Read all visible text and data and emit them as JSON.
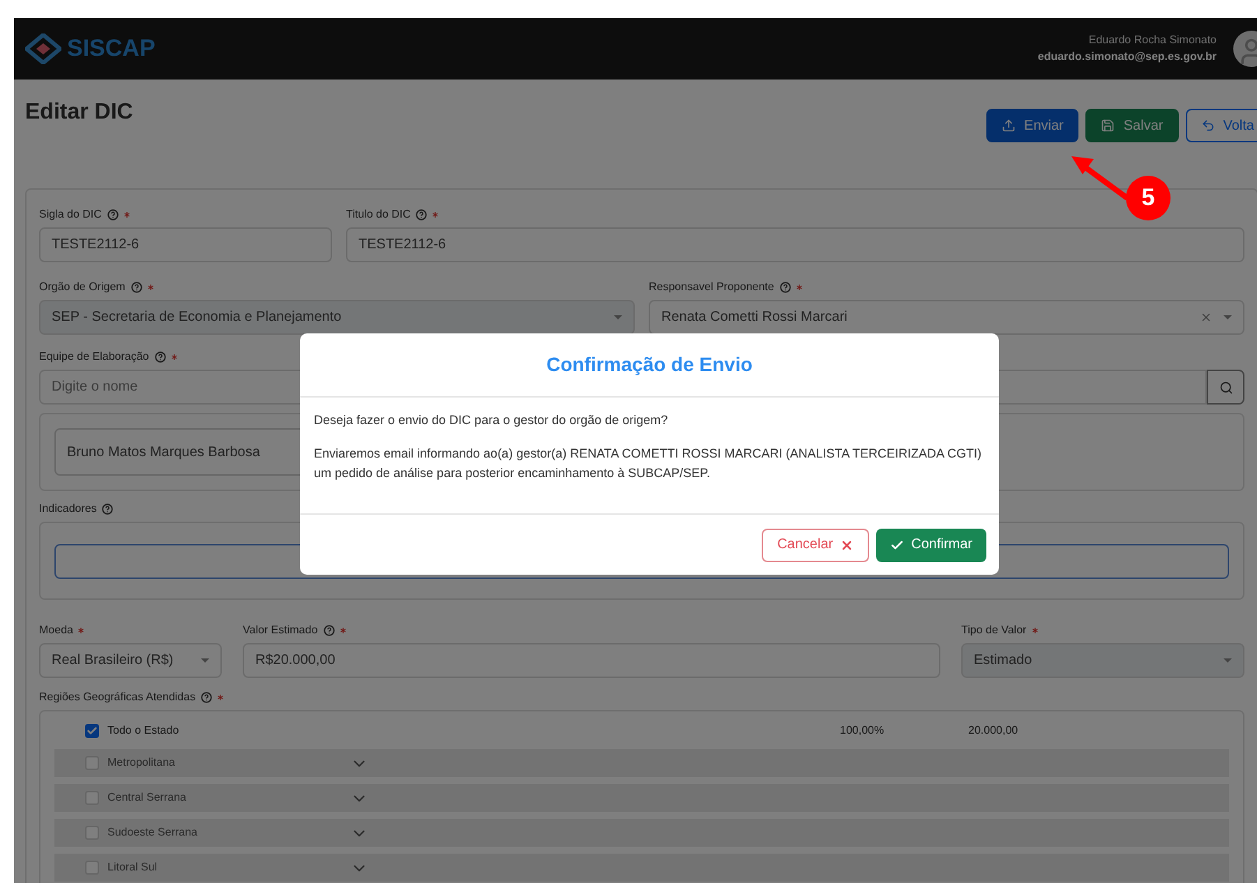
{
  "header": {
    "logo_text": "SISCAP",
    "user_name": "Eduardo Rocha Simonato",
    "user_email": "eduardo.simonato@sep.es.gov.br"
  },
  "page": {
    "title": "Editar DIC",
    "actions": [
      {
        "kind": "send",
        "label": "Enviar"
      },
      {
        "kind": "save",
        "label": "Salvar"
      },
      {
        "kind": "back",
        "label": "Volta"
      }
    ]
  },
  "form": {
    "sigla": {
      "label": "Sigla do DIC",
      "help": true,
      "required": true,
      "value": "TESTE2112-6"
    },
    "titulo": {
      "label": "Titulo do DIC",
      "help": true,
      "required": true,
      "value": "TESTE2112-6"
    },
    "orgao": {
      "label": "Orgão de Origem",
      "help": true,
      "required": true,
      "value": "SEP - Secretaria de Economia e Planejamento"
    },
    "responsavel": {
      "label": "Responsavel Proponente",
      "help": true,
      "required": true,
      "value": "Renata Cometti Rossi Marcari"
    },
    "equipe": {
      "label": "Equipe de Elaboração",
      "help": true,
      "required": true,
      "placeholder": "Digite o nome",
      "members": [
        "Bruno Matos Marques Barbosa"
      ]
    },
    "indicadores": {
      "label": "Indicadores",
      "help": true,
      "required": false
    },
    "moeda": {
      "label": "Moeda",
      "help": false,
      "required": true,
      "value": "Real Brasileiro (R$)"
    },
    "valor": {
      "label": "Valor Estimado",
      "help": true,
      "required": true,
      "value": "R$20.000,00"
    },
    "tipo": {
      "label": "Tipo de Valor",
      "help": false,
      "required": true,
      "value": "Estimado"
    },
    "regioes": {
      "label": "Regiões Geográficas Atendidas",
      "help": true,
      "required": true,
      "items": [
        {
          "kind": "total",
          "name": "Todo o Estado",
          "checked": true,
          "percent": "100,00%",
          "amount": "20.000,00"
        },
        {
          "kind": "region",
          "name": "Metropolitana",
          "checked": false
        },
        {
          "kind": "region",
          "name": "Central Serrana",
          "checked": false
        },
        {
          "kind": "region",
          "name": "Sudoeste Serrana",
          "checked": false
        },
        {
          "kind": "region",
          "name": "Litoral Sul",
          "checked": false
        }
      ]
    }
  },
  "modal": {
    "title": "Confirmação de Envio",
    "paragraphs": [
      "Deseja fazer o envio do DIC para o gestor do orgão de origem?",
      "Enviaremos email informando ao(a) gestor(a) RENATA COMETTI ROSSI MARCARI (ANALISTA TERCEIRIZADA CGTI) um pedido de análise para posterior encaminhamento à SUBCAP/SEP."
    ],
    "cancel": "Cancelar",
    "confirm": "Confirmar"
  },
  "annotation": {
    "number": "5"
  }
}
